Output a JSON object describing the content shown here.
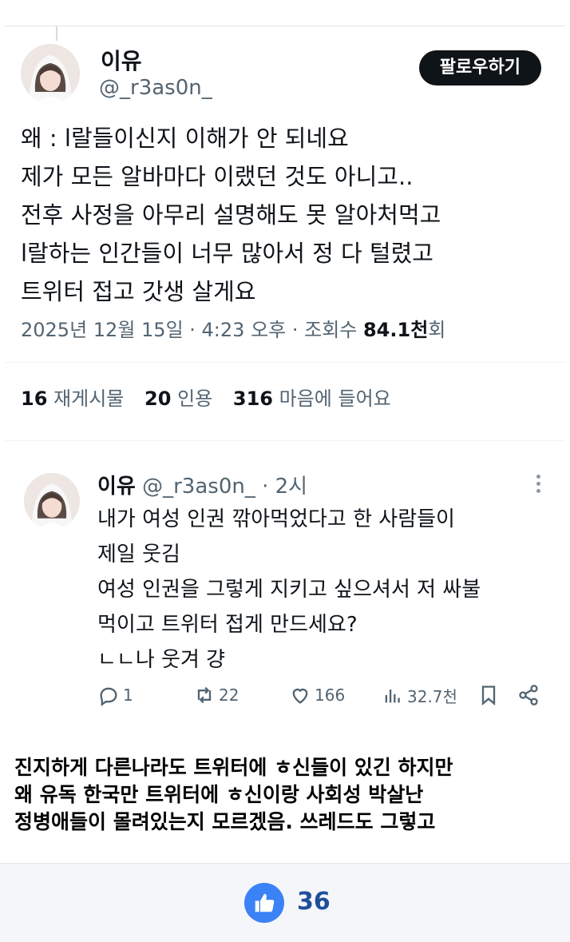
{
  "tweet": {
    "display_name": "이유",
    "handle": "@_r3as0n_",
    "follow_label": "팔로우하기",
    "lines": [
      "왜 :  l랄들이신지 이해가 안 되네요",
      "제가 모든 알바마다 이랬던 것도 아니고..",
      "전후 사정을 아무리 설명해도 못 알아처먹고",
      "  l랄하는 인간들이 너무 많아서 정 다 털렸고",
      "트위터 접고 갓생 살게요"
    ],
    "meta_prefix": "2025년 12월 15일 · 4:23 오후 · 조회수 ",
    "views": "84.1천",
    "views_suffix": "회",
    "stats": [
      {
        "num": "16",
        "label": "재게시물"
      },
      {
        "num": "20",
        "label": "인용"
      },
      {
        "num": "316",
        "label": "마음에 들어요"
      }
    ]
  },
  "reply": {
    "display_name": "이유",
    "handle_time": " @_r3as0n_ · 2시",
    "lines": [
      "내가 여성 인권 깎아먹었다고 한 사람들이",
      "제일 웃김",
      "여성 인권을 그렇게 지키고 싶으셔서 저 싸불",
      "먹이고 트위터 접게 만드세요?",
      "ㄴㄴ나 웃겨 걍"
    ],
    "actions": {
      "replies": "1",
      "reposts": "22",
      "likes": "166",
      "views": "32.7천"
    },
    "icons": [
      "reply-icon",
      "repost-icon",
      "heart-icon",
      "views-icon",
      "bookmark-icon",
      "share-icon"
    ]
  },
  "caption": {
    "lines": [
      "진지하게 다른나라도 트위터에 ㅎ신들이 있긴 하지만",
      "왜 유독 한국만 트위터에 ㅎ신이랑 사회성 박살난",
      "정병애들이 몰려있는지 모르겠음. 쓰레드도 그렇고"
    ]
  },
  "like_bar": {
    "count": "36",
    "icon": "thumbs-up-icon",
    "accent": "#3b82f6"
  }
}
